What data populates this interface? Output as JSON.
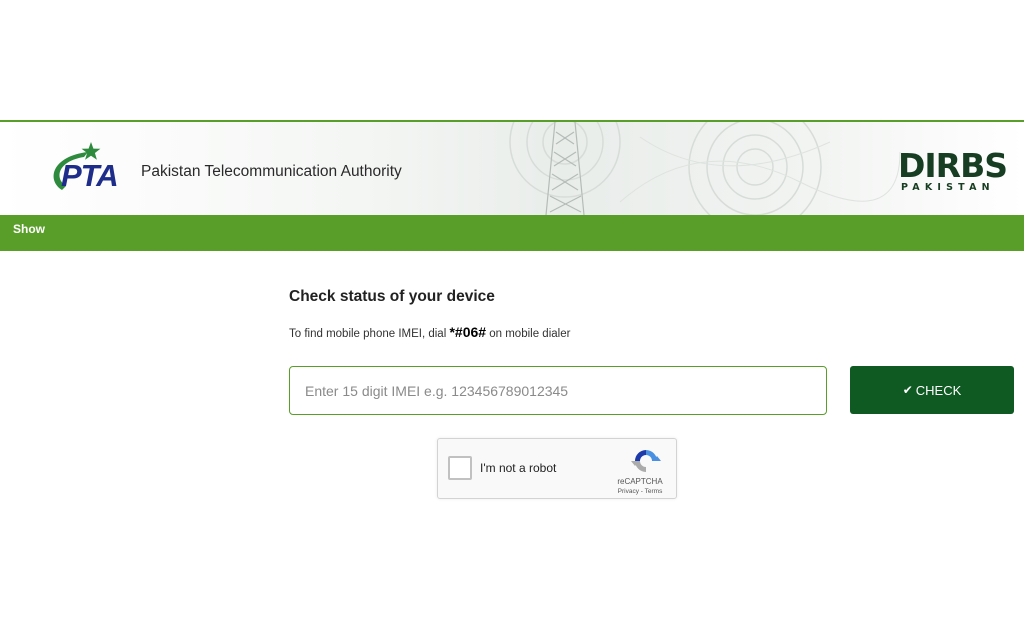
{
  "header": {
    "org_abbr": "PTA",
    "org_name": "Pakistan Telecommunication Authority",
    "dirbs_logo": "DIRBS",
    "dirbs_sub": "PAKISTAN"
  },
  "nav": {
    "show_label": "Show"
  },
  "main": {
    "title": "Check status of your device",
    "hint_prefix": "To find mobile phone IMEI, dial ",
    "hint_code": "*#06#",
    "hint_suffix": " on mobile dialer",
    "imei_placeholder": "Enter 15 digit IMEI e.g. 123456789012345",
    "imei_value": "",
    "check_label": "CHECK"
  },
  "captcha": {
    "label": "I'm not a robot",
    "brand": "reCAPTCHA",
    "privacy": "Privacy",
    "separator": " - ",
    "terms": "Terms"
  },
  "colors": {
    "brand_green": "#5a9e2a",
    "dark_green": "#0f5a22",
    "pta_navy": "#1e2d8a",
    "pta_star_green": "#2e8b3e"
  },
  "icons": {
    "check_button": "checkmark-icon",
    "captcha_logo": "recaptcha-icon",
    "pta_logo": "pta-star-logo"
  }
}
